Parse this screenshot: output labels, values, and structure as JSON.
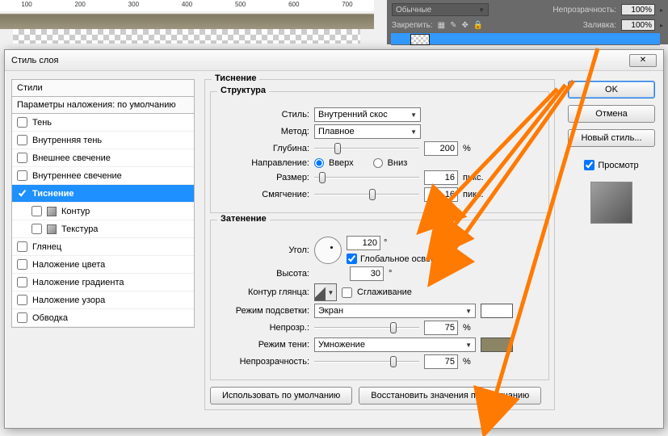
{
  "ruler_ticks": [
    "100",
    "200",
    "300",
    "400",
    "500",
    "600",
    "700"
  ],
  "layers_panel": {
    "mode_label": "Обычные",
    "opacity_label": "Непрозрачность:",
    "opacity_value": "100%",
    "lock_label": "Закрепить:",
    "fill_label": "Заливка:",
    "fill_value": "100%"
  },
  "dialog": {
    "title": "Стиль слоя",
    "close_icon": "✕",
    "styles_header": "Стили",
    "blend_header": "Параметры наложения: по умолчанию",
    "style_rows": [
      {
        "label": "Тень",
        "checked": false,
        "sub": false,
        "sel": false
      },
      {
        "label": "Внутренняя тень",
        "checked": false,
        "sub": false,
        "sel": false
      },
      {
        "label": "Внешнее свечение",
        "checked": false,
        "sub": false,
        "sel": false
      },
      {
        "label": "Внутреннее свечение",
        "checked": false,
        "sub": false,
        "sel": false
      },
      {
        "label": "Тиснение",
        "checked": true,
        "sub": false,
        "sel": true
      },
      {
        "label": "Контур",
        "checked": false,
        "sub": true,
        "sel": false
      },
      {
        "label": "Текстура",
        "checked": false,
        "sub": true,
        "sel": false
      },
      {
        "label": "Глянец",
        "checked": false,
        "sub": false,
        "sel": false
      },
      {
        "label": "Наложение цвета",
        "checked": false,
        "sub": false,
        "sel": false
      },
      {
        "label": "Наложение градиента",
        "checked": false,
        "sub": false,
        "sel": false
      },
      {
        "label": "Наложение узора",
        "checked": false,
        "sub": false,
        "sel": false
      },
      {
        "label": "Обводка",
        "checked": false,
        "sub": false,
        "sel": false
      }
    ],
    "outer_legend": "Тиснение",
    "structure": {
      "legend": "Структура",
      "style_label": "Стиль:",
      "style_value": "Внутренний скос",
      "method_label": "Метод:",
      "method_value": "Плавное",
      "depth_label": "Глубина:",
      "depth_value": "200",
      "depth_unit": "%",
      "direction_label": "Направление:",
      "dir_up": "Вверх",
      "dir_down": "Вниз",
      "size_label": "Размер:",
      "size_value": "16",
      "size_unit": "пикс.",
      "soften_label": "Смягчение:",
      "soften_value": "16",
      "soften_unit": "пикс."
    },
    "shading": {
      "legend": "Затенение",
      "angle_label": "Угол:",
      "angle_value": "120",
      "deg": "°",
      "global_light": "Глобальное освещение",
      "altitude_label": "Высота:",
      "altitude_value": "30",
      "gloss_label": "Контур глянца:",
      "antialias": "Сглаживание",
      "highlight_mode_label": "Режим подсветки:",
      "highlight_mode_value": "Экран",
      "highlight_swatch": "#ffffff",
      "opacity_label": "Непрозр.:",
      "opacity_value": "75",
      "opacity_unit": "%",
      "shadow_mode_label": "Режим тени:",
      "shadow_mode_value": "Умножение",
      "shadow_swatch": "#8b8566",
      "opacity2_label": "Непрозрачность:",
      "opacity2_value": "75",
      "opacity2_unit": "%"
    },
    "defaults_btn": "Использовать по умолчанию",
    "reset_btn": "Восстановить значения по умолчанию",
    "ok": "OK",
    "cancel": "Отмена",
    "new_style": "Новый стиль...",
    "preview": "Просмотр"
  }
}
